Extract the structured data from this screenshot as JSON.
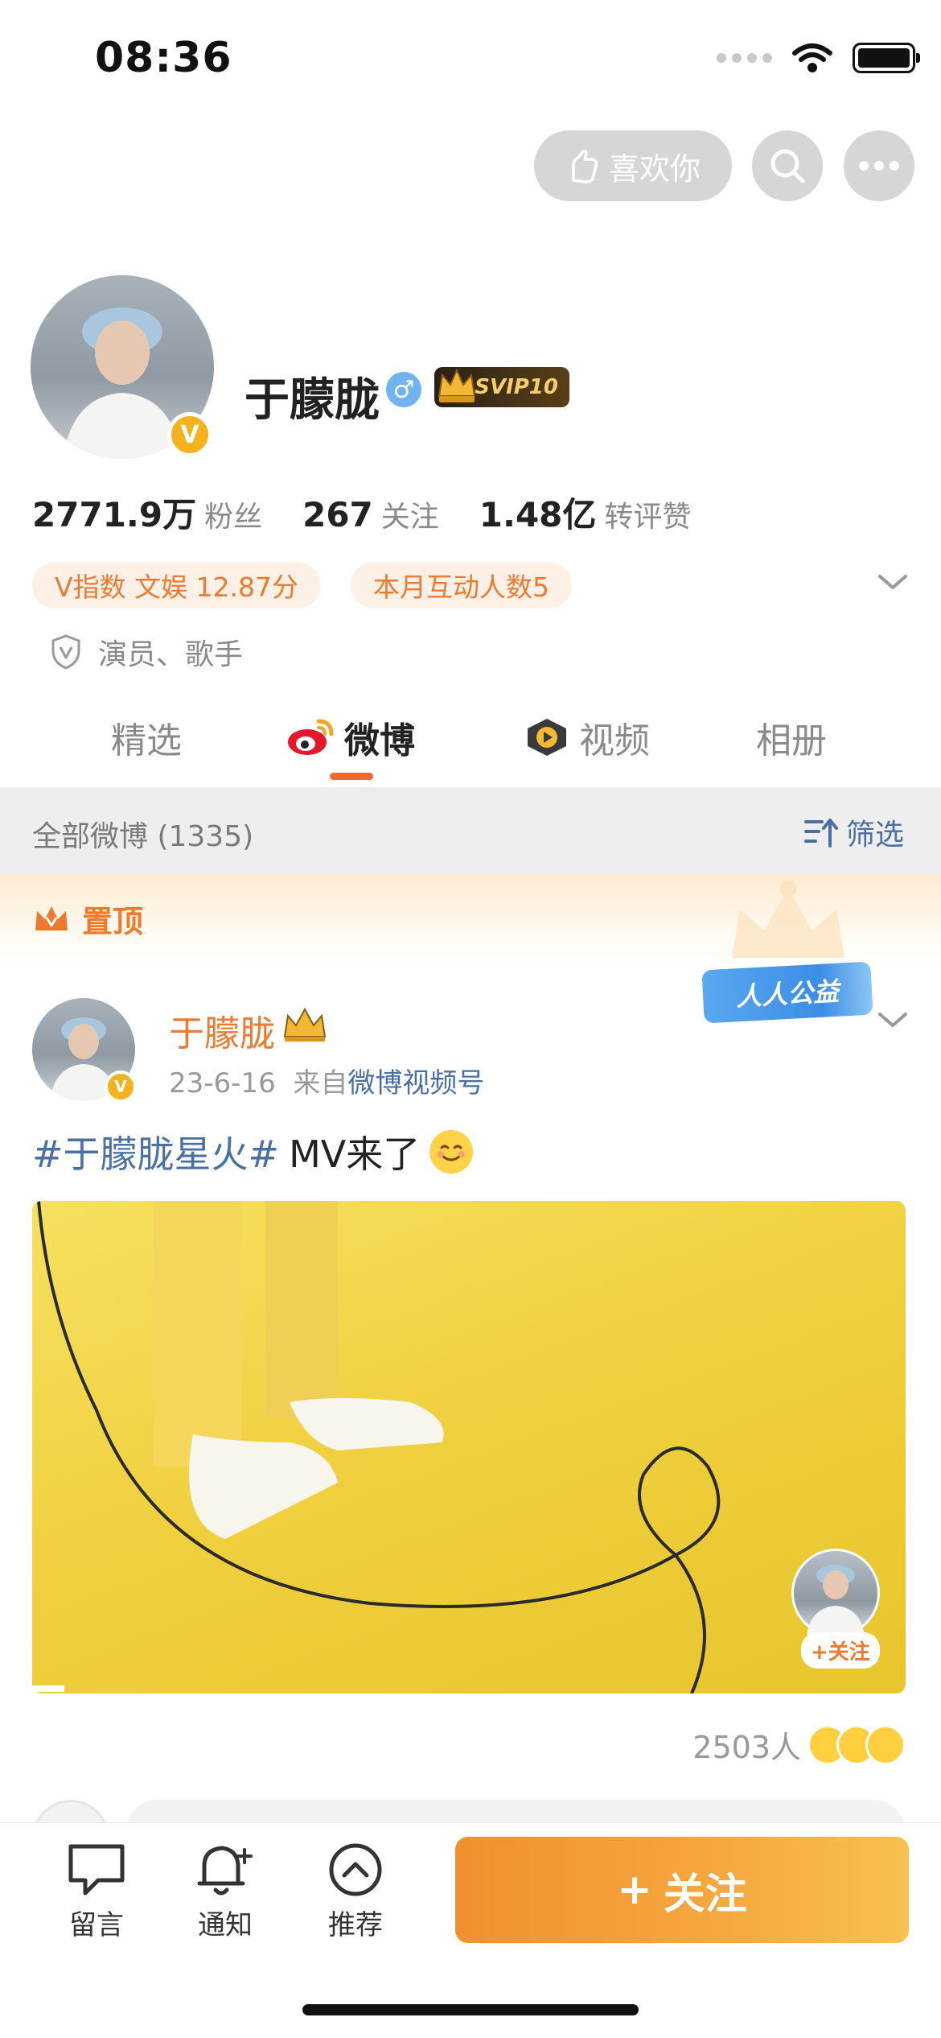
{
  "status_bar": {
    "time": "08:36"
  },
  "top_actions": {
    "like_label": "喜欢你"
  },
  "profile": {
    "name": "于朦胧",
    "gender_symbol": "♂",
    "avatar_badge": "V",
    "svip_label": "SVIP10",
    "stats": [
      {
        "value": "2771.9万",
        "label": "粉丝"
      },
      {
        "value": "267",
        "label": "关注"
      },
      {
        "value": "1.48亿",
        "label": "转评赞"
      }
    ],
    "tags": {
      "vindex": "V指数 文娱 12.87分",
      "month_interactions": "本月互动人数5"
    },
    "profession": "演员、歌手"
  },
  "tabs": {
    "featured": "精选",
    "weibo": "微博",
    "video": "视频",
    "album": "相册"
  },
  "filter_bar": {
    "all_posts": "全部微博 (1335)",
    "filter_label": "筛选"
  },
  "pinned": {
    "label": "置顶"
  },
  "post": {
    "author": "于朦胧",
    "avatar_badge": "V",
    "date": "23-6-16",
    "source_prefix": "来自",
    "source": "微博视频号",
    "charity_badge": "人人公益",
    "hashtag": "#于朦胧星火#",
    "text": "MV来了",
    "media_follow_label": "+关注",
    "reaction_count": "2503人"
  },
  "bottom_bar": {
    "message": "留言",
    "notify": "通知",
    "recommend": "推荐",
    "follow": "关注",
    "follow_plus": "+"
  },
  "colors": {
    "accent": "#ee7a30",
    "link": "#4a6fa5",
    "follow_button_start": "#f09030",
    "follow_button_end": "#f8c050"
  }
}
